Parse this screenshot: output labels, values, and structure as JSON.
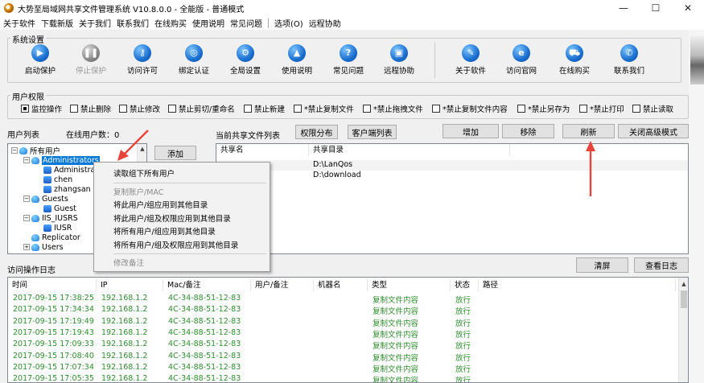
{
  "window": {
    "title": "大势至局域网共享文件管理系统 V10.8.0.0 - 全能版 - 普通模式",
    "minimize": "—",
    "maximize": "☐",
    "close": "✕"
  },
  "menu": [
    "关于软件",
    "下载新版",
    "关于我们",
    "联系我们",
    "在线购买",
    "使用说明",
    "常见问题",
    "选项(O)",
    "远程协助"
  ],
  "system_settings": {
    "label": "系统设置",
    "buttons": [
      {
        "label": "启动保护",
        "icon": "play-icon",
        "glyph": "▶",
        "disabled": false
      },
      {
        "label": "停止保护",
        "icon": "pause-icon",
        "glyph": "❚❚",
        "disabled": true
      },
      {
        "label": "访问许可",
        "icon": "key-icon",
        "glyph": "⚷",
        "disabled": false
      },
      {
        "label": "绑定认证",
        "icon": "network-icon",
        "glyph": "◎",
        "disabled": false
      },
      {
        "label": "全局设置",
        "icon": "gear-icon",
        "glyph": "⚙",
        "disabled": false
      },
      {
        "label": "使用说明",
        "icon": "graduation-cap-icon",
        "glyph": "▲",
        "disabled": false
      },
      {
        "label": "常见问题",
        "icon": "question-icon",
        "glyph": "?",
        "disabled": false
      },
      {
        "label": "远程协助",
        "icon": "remote-desktop-icon",
        "glyph": "▣",
        "disabled": false
      },
      {
        "label": "关于软件",
        "icon": "tools-icon",
        "glyph": "✎",
        "disabled": false
      },
      {
        "label": "访问官网",
        "icon": "ie-icon",
        "glyph": "e",
        "disabled": false
      },
      {
        "label": "在线购买",
        "icon": "cart-icon",
        "glyph": "⛟",
        "disabled": false
      },
      {
        "label": "联系我们",
        "icon": "chat-icon",
        "glyph": "✆",
        "disabled": false
      }
    ]
  },
  "user_permissions": {
    "label": "用户权限",
    "checkboxes": [
      {
        "label": "监控操作",
        "checked": true
      },
      {
        "label": "禁止删除",
        "checked": false
      },
      {
        "label": "禁止修改",
        "checked": false
      },
      {
        "label": "禁止剪切/重命名",
        "checked": false
      },
      {
        "label": "禁止新建",
        "checked": false
      },
      {
        "label": "*禁止复制文件",
        "checked": false
      },
      {
        "label": "*禁止拖拽文件",
        "checked": false
      },
      {
        "label": "*禁止复制文件内容",
        "checked": false
      },
      {
        "label": "*禁止另存为",
        "checked": false
      },
      {
        "label": "*禁止打印",
        "checked": false
      },
      {
        "label": "禁止读取",
        "checked": false
      }
    ]
  },
  "user_list": {
    "label": "用户列表",
    "online_label": "在线用户数：0",
    "add_button": "添加",
    "tree": [
      {
        "text": "所有用户",
        "level": 0,
        "type": "group",
        "expander": "−"
      },
      {
        "text": "Administrators",
        "level": 1,
        "type": "group",
        "expander": "−",
        "selected": true
      },
      {
        "text": "Administrator",
        "level": 2,
        "type": "user"
      },
      {
        "text": "chen",
        "level": 2,
        "type": "user"
      },
      {
        "text": "zhangsan",
        "level": 2,
        "type": "user"
      },
      {
        "text": "Guests",
        "level": 1,
        "type": "group",
        "expander": "−"
      },
      {
        "text": "Guest",
        "level": 2,
        "type": "user"
      },
      {
        "text": "IIS_IUSRS",
        "level": 1,
        "type": "group",
        "expander": "−"
      },
      {
        "text": "IUSR",
        "level": 2,
        "type": "user"
      },
      {
        "text": "Replicator",
        "level": 1,
        "type": "group",
        "expander": ""
      },
      {
        "text": "Users",
        "level": 1,
        "type": "group",
        "expander": "+"
      }
    ]
  },
  "shares": {
    "label": "当前共享文件列表",
    "buttons": {
      "perm": "权限分布",
      "client": "客户端列表",
      "add": "增加",
      "remove": "移除",
      "refresh": "刷新",
      "advanced": "关闭高级模式"
    },
    "columns": [
      "共享名",
      "共享目录"
    ],
    "rows": [
      {
        "name": "",
        "path": "D:\\LanQos"
      },
      {
        "name": "",
        "path": "D:\\download"
      }
    ]
  },
  "context_menu": {
    "items": [
      {
        "label": "读取组下所有用户",
        "disabled": false
      },
      {
        "sep": true
      },
      {
        "label": "复制账户/MAC",
        "disabled": true
      },
      {
        "label": "将此用户/组应用到其他目录",
        "disabled": false
      },
      {
        "label": "将此用户/组及权限应用到其他目录",
        "disabled": false
      },
      {
        "label": "将所有用户/组应用到其他目录",
        "disabled": false
      },
      {
        "label": "将所有用户/组及权限应用到其他目录",
        "disabled": false
      },
      {
        "sep": true
      },
      {
        "label": "修改备注",
        "disabled": true
      }
    ]
  },
  "log": {
    "label": "访问操作日志",
    "clear_button": "清屏",
    "view_button": "查看日志",
    "columns": [
      "时间",
      "IP",
      "Mac/备注",
      "用户/备注",
      "机器名",
      "类型",
      "状态",
      "路径"
    ],
    "rows": [
      {
        "time": "2017-09-15 17:38:25",
        "ip": "192.168.1.2",
        "mac": "4C-34-88-51-12-83",
        "user": "",
        "machine": "",
        "type": "复制文件内容",
        "status": "放行",
        "path": ""
      },
      {
        "time": "2017-09-15 17:34:34",
        "ip": "192.168.1.2",
        "mac": "4C-34-88-51-12-83",
        "user": "",
        "machine": "",
        "type": "复制文件内容",
        "status": "放行",
        "path": ""
      },
      {
        "time": "2017-09-15 17:19:49",
        "ip": "192.168.1.2",
        "mac": "4C-34-88-51-12-83",
        "user": "",
        "machine": "",
        "type": "复制文件内容",
        "status": "放行",
        "path": ""
      },
      {
        "time": "2017-09-15 17:19:43",
        "ip": "192.168.1.2",
        "mac": "4C-34-88-51-12-83",
        "user": "",
        "machine": "",
        "type": "复制文件内容",
        "status": "放行",
        "path": ""
      },
      {
        "time": "2017-09-15 17:09:33",
        "ip": "192.168.1.2",
        "mac": "4C-34-88-51-12-83",
        "user": "",
        "machine": "",
        "type": "复制文件内容",
        "status": "放行",
        "path": ""
      },
      {
        "time": "2017-09-15 17:08:40",
        "ip": "192.168.1.2",
        "mac": "4C-34-88-51-12-83",
        "user": "",
        "machine": "",
        "type": "复制文件内容",
        "status": "放行",
        "path": ""
      },
      {
        "time": "2017-09-15 17:07:34",
        "ip": "192.168.1.2",
        "mac": "4C-34-88-51-12-83",
        "user": "",
        "machine": "",
        "type": "复制文件内容",
        "status": "放行",
        "path": ""
      },
      {
        "time": "2017-09-15 17:05:35",
        "ip": "192.168.1.2",
        "mac": "4C-34-88-51-12-83",
        "user": "",
        "machine": "",
        "type": "复制文件内容",
        "status": "放行",
        "path": ""
      }
    ]
  },
  "colors": {
    "log_text": "#2f8f2f",
    "selection": "#0078d7",
    "annotation_arrow": "#e8443a"
  }
}
